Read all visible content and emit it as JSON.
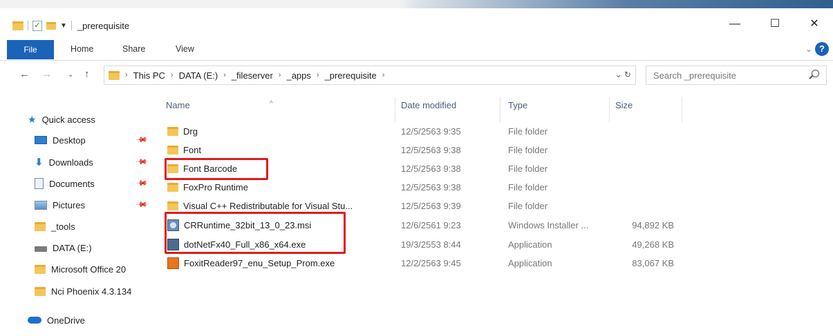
{
  "window": {
    "title": "_prerequisite",
    "minimize": "—",
    "maximize": "☐",
    "close": "✕"
  },
  "ribbon": {
    "tabs": [
      "File",
      "Home",
      "Share",
      "View"
    ],
    "help": "?"
  },
  "address": {
    "crumbs": [
      "This PC",
      "DATA (E:)",
      "_fileserver",
      "_apps",
      "_prerequisite"
    ],
    "search_placeholder": "Search _prerequisite"
  },
  "nav": {
    "quick_access": "Quick access",
    "items": [
      "Desktop",
      "Downloads",
      "Documents",
      "Pictures",
      "_tools",
      "DATA (E:)",
      "Microsoft Office 20",
      "Nci Phoenix 4.3.134"
    ],
    "onedrive": "OneDrive"
  },
  "columns": {
    "name": "Name",
    "date": "Date modified",
    "type": "Type",
    "size": "Size"
  },
  "files": [
    {
      "name": "Drg",
      "date": "12/5/2563 9:35",
      "type": "File folder",
      "size": "",
      "icon": "folder-icon"
    },
    {
      "name": "Font",
      "date": "12/5/2563 9:38",
      "type": "File folder",
      "size": "",
      "icon": "folder-icon"
    },
    {
      "name": "Font Barcode",
      "date": "12/5/2563 9:38",
      "type": "File folder",
      "size": "",
      "icon": "folder-icon"
    },
    {
      "name": "FoxPro Runtime",
      "date": "12/5/2563 9:38",
      "type": "File folder",
      "size": "",
      "icon": "folder-icon"
    },
    {
      "name": "Visual C++ Redistributable for Visual Stu...",
      "date": "12/5/2563 9:39",
      "type": "File folder",
      "size": "",
      "icon": "folder-icon"
    },
    {
      "name": "CRRuntime_32bit_13_0_23.msi",
      "date": "12/6/2561 9:23",
      "type": "Windows Installer ...",
      "size": "94,892 KB",
      "icon": "msi-icon"
    },
    {
      "name": "dotNetFx40_Full_x86_x64.exe",
      "date": "19/3/2553 8:44",
      "type": "Application",
      "size": "49,268 KB",
      "icon": "exe-icon"
    },
    {
      "name": "FoxitReader97_enu_Setup_Prom.exe",
      "date": "12/2/2563 9:45",
      "type": "Application",
      "size": "83,067 KB",
      "icon": "foxit-icon"
    }
  ],
  "colors": {
    "accent": "#1a63b8",
    "highlight": "#e11b1b",
    "folder": "#f4c65a"
  }
}
